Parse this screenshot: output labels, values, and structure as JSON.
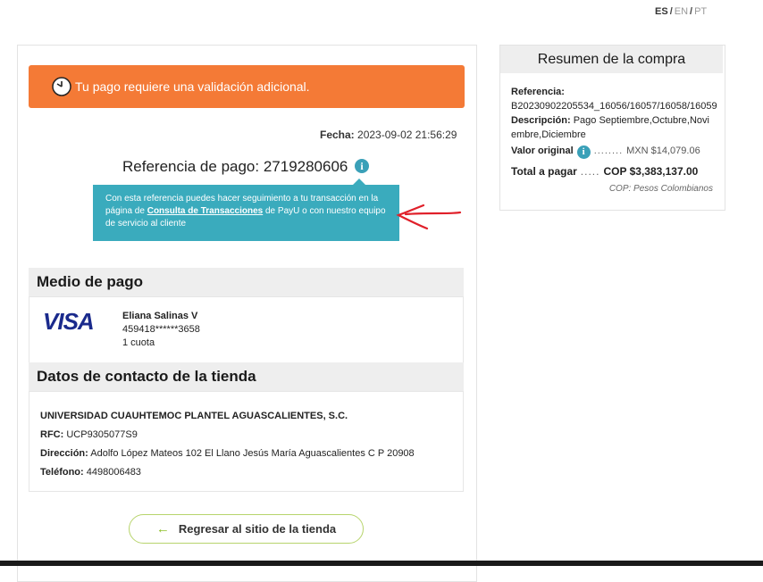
{
  "languages": {
    "active": "ES",
    "others": [
      "EN",
      "PT"
    ],
    "separator": "/"
  },
  "alert": {
    "text": "Tu pago requiere una validación adicional.",
    "icon": "clock-icon",
    "color": "#f47a36"
  },
  "fecha": {
    "label": "Fecha:",
    "value": "2023-09-02  21:56:29"
  },
  "reference": {
    "title": "Referencia de pago: 2719280606",
    "info_icon": "info-icon"
  },
  "tooltip": {
    "text_before": "Con esta referencia puedes hacer seguimiento a tu transacción en la página de ",
    "link": "Consulta de Transacciones",
    "text_after": " de PayU o con nuestro equipo de servicio al cliente"
  },
  "payment_method": {
    "heading": "Medio de pago",
    "brand": "VISA",
    "holder": "Eliana Salinas V",
    "card_number": "459418******3658",
    "installments": "1 cuota"
  },
  "store_contact": {
    "heading": "Datos de contacto de la tienda",
    "name": "UNIVERSIDAD CUAUHTEMOC PLANTEL AGUASCALIENTES, S.C.",
    "rfc_label": "RFC:",
    "rfc": "UCP9305077S9",
    "address_label": "Dirección:",
    "address": "Adolfo López Mateos 102 El Llano Jesús María Aguascalientes C P 20908",
    "phone_label": "Teléfono:",
    "phone": "4498006483"
  },
  "back_button": {
    "arrow": "←",
    "label": "Regresar al sitio de la tienda"
  },
  "summary": {
    "title": "Resumen de la compra",
    "reference_label": "Referencia:",
    "reference": "B20230902205534_16056/16057/16058/16059",
    "description_label": "Descripción:",
    "description": "Pago Septiembre,Octubre,Noviembre,Diciembre",
    "original_label": "Valor original",
    "original_dots": "........",
    "original_value": "MXN $14,079.06",
    "total_label": "Total a pagar",
    "total_dots": ".....",
    "total_value": "COP $3,383,137.00",
    "currency_note": "COP: Pesos Colombianos"
  },
  "colors": {
    "accent_orange": "#f47a36",
    "tooltip_teal": "#3aabbd",
    "button_border": "#b7d46c",
    "visa_blue": "#1a2a8c",
    "annotation_red": "#e0202a"
  }
}
